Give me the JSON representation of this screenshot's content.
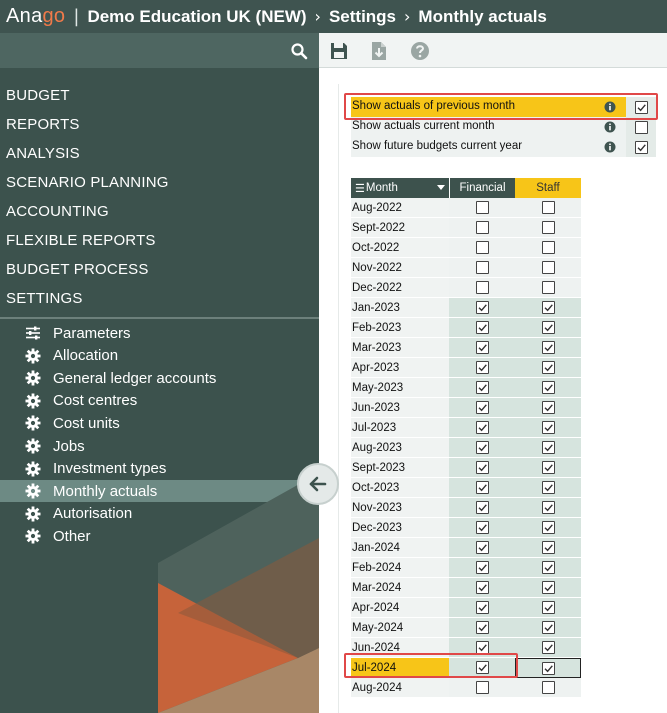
{
  "header": {
    "logo_prefix": "Ana",
    "logo_highlight": "go",
    "separator": "|",
    "breadcrumbs": [
      "Demo Education UK (NEW)",
      "Settings",
      "Monthly actuals"
    ]
  },
  "sidebar": {
    "menu": [
      "BUDGET",
      "REPORTS",
      "ANALYSIS",
      "SCENARIO PLANNING",
      "ACCOUNTING",
      "FLEXIBLE REPORTS",
      "BUDGET PROCESS",
      "SETTINGS"
    ],
    "settings_items": [
      {
        "label": "Parameters",
        "icon": "sliders-icon",
        "active": false
      },
      {
        "label": "Allocation",
        "icon": "gear-icon",
        "active": false
      },
      {
        "label": "General ledger accounts",
        "icon": "gear-icon",
        "active": false
      },
      {
        "label": "Cost centres",
        "icon": "gear-icon",
        "active": false
      },
      {
        "label": "Cost units",
        "icon": "gear-icon",
        "active": false
      },
      {
        "label": "Jobs",
        "icon": "gear-icon",
        "active": false
      },
      {
        "label": "Investment types",
        "icon": "gear-icon",
        "active": false
      },
      {
        "label": "Monthly actuals",
        "icon": "gear-icon",
        "active": true
      },
      {
        "label": "Autorisation",
        "icon": "gear-icon",
        "active": false
      },
      {
        "label": "Other",
        "icon": "gear-icon",
        "active": false
      }
    ]
  },
  "toolbar": {
    "icons": [
      "save-icon",
      "export-icon",
      "help-icon"
    ]
  },
  "options": [
    {
      "label": "Show actuals of previous month",
      "checked": true,
      "highlight": true
    },
    {
      "label": "Show actuals current month",
      "checked": false,
      "highlight": false
    },
    {
      "label": "Show future budgets current year",
      "checked": true,
      "highlight": false
    }
  ],
  "table": {
    "columns": {
      "month": "Month",
      "financial": "Financial",
      "staff": "Staff"
    },
    "rows": [
      {
        "month": "Aug-2022",
        "financial": false,
        "staff": false
      },
      {
        "month": "Sept-2022",
        "financial": false,
        "staff": false
      },
      {
        "month": "Oct-2022",
        "financial": false,
        "staff": false
      },
      {
        "month": "Nov-2022",
        "financial": false,
        "staff": false
      },
      {
        "month": "Dec-2022",
        "financial": false,
        "staff": false
      },
      {
        "month": "Jan-2023",
        "financial": true,
        "staff": true
      },
      {
        "month": "Feb-2023",
        "financial": true,
        "staff": true
      },
      {
        "month": "Mar-2023",
        "financial": true,
        "staff": true
      },
      {
        "month": "Apr-2023",
        "financial": true,
        "staff": true
      },
      {
        "month": "May-2023",
        "financial": true,
        "staff": true
      },
      {
        "month": "Jun-2023",
        "financial": true,
        "staff": true
      },
      {
        "month": "Jul-2023",
        "financial": true,
        "staff": true
      },
      {
        "month": "Aug-2023",
        "financial": true,
        "staff": true
      },
      {
        "month": "Sept-2023",
        "financial": true,
        "staff": true
      },
      {
        "month": "Oct-2023",
        "financial": true,
        "staff": true
      },
      {
        "month": "Nov-2023",
        "financial": true,
        "staff": true
      },
      {
        "month": "Dec-2023",
        "financial": true,
        "staff": true
      },
      {
        "month": "Jan-2024",
        "financial": true,
        "staff": true
      },
      {
        "month": "Feb-2024",
        "financial": true,
        "staff": true
      },
      {
        "month": "Mar-2024",
        "financial": true,
        "staff": true
      },
      {
        "month": "Apr-2024",
        "financial": true,
        "staff": true
      },
      {
        "month": "May-2024",
        "financial": true,
        "staff": true
      },
      {
        "month": "Jun-2024",
        "financial": true,
        "staff": true
      },
      {
        "month": "Jul-2024",
        "financial": true,
        "staff": true,
        "highlight": true,
        "selected_staff": true
      },
      {
        "month": "Aug-2024",
        "financial": false,
        "staff": false
      }
    ]
  },
  "colors": {
    "sidebar_bg": "#3c524d",
    "header_bg": "#3f5450",
    "accent_yellow": "#f7c518",
    "logo_orange": "#f07a4a",
    "annotation_red": "#e04848"
  }
}
